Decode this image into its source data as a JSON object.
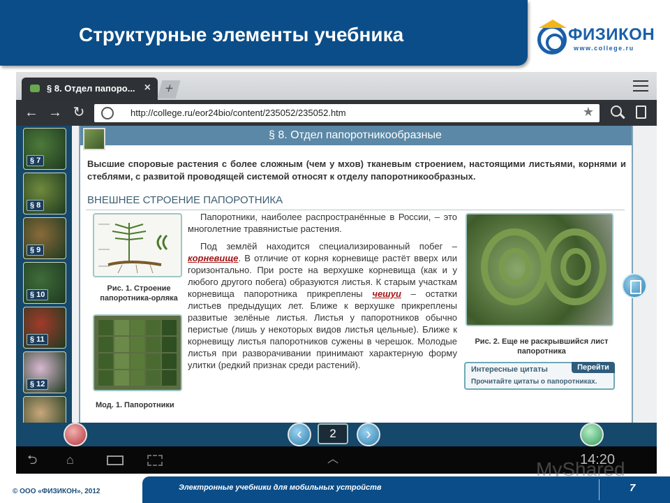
{
  "header": {
    "title": "Структурные элементы учебника"
  },
  "logo": {
    "name": "ФИЗИКОН",
    "url": "www.college.ru"
  },
  "browser": {
    "tab_label": "§ 8. Отдел папоро...",
    "tab_close": "×",
    "new_tab": "+",
    "url": "http://college.ru/eor24bio/content/235052/235052.htm",
    "back": "←",
    "forward": "→",
    "reload": "↻",
    "star": "★"
  },
  "thumbnails": [
    {
      "label": "§ 7",
      "color": "#4d7a3a"
    },
    {
      "label": "§ 8",
      "color": "#6f8a3c"
    },
    {
      "label": "§ 9",
      "color": "#8a6a3a"
    },
    {
      "label": "§ 10",
      "color": "#3f6b3a"
    },
    {
      "label": "§ 11",
      "color": "#a33a2a"
    },
    {
      "label": "§ 12",
      "color": "#d8b8d0"
    },
    {
      "label": "",
      "color": "#c9a77a"
    }
  ],
  "page": {
    "section_title": "§ 8. Отдел папоротникообразные",
    "intro": "Высшие споровые растения с более сложным (чем у мхов) тканевым строением, настоящими листьями, корнями и стеблями, с развитой проводящей системой относят к отделу папоротникообразных.",
    "subhead": "ВНЕШНЕЕ СТРОЕНИЕ ПАПОРОТНИКА",
    "para1": "Папоротники, наиболее распространённые в России, – это многолетние травянистые растения.",
    "para2_a": "Под землёй находится специализированный побег –",
    "term1": "корневище",
    "para2_b": ". В отличие от корня корневище растёт вверх или горизонтально. При росте на верхушке корневища (как и у любого другого побега) образуются листья. К старым участкам корневища папоротника прикреплены",
    "term2": "чешуи",
    "para2_c": "– остатки листьев предыдущих лет. Ближе к верхушке прикреплены развитые зелёные листья. Листья у папоротников обычно перистые (лишь у некоторых видов листья цельные). Ближе к корневищу листья папоротников сужены в черешок. Молодые листья при разворачивании принимают характерную форму улитки (редкий признак среди растений).",
    "fig1_caption": "Рис. 1. Строение папоротника-орляка",
    "mod1_caption": "Мод. 1. Папоротники",
    "fig2_caption": "Рис. 2. Еще не раскрывшийся лист папоротника",
    "quote_title": "Интересные цитаты",
    "quote_go": "Перейти",
    "quote_text": "Прочитайте цитаты о папоротниках."
  },
  "reader": {
    "page_number": "2",
    "prev": "‹",
    "next": "›"
  },
  "system": {
    "clock": "14:20"
  },
  "watermark": "MyShared",
  "footer": {
    "copyright": "© ООО «ФИЗИКОН», 2012",
    "text": "Электронные учебники для мобильных устройств",
    "page": "7"
  }
}
